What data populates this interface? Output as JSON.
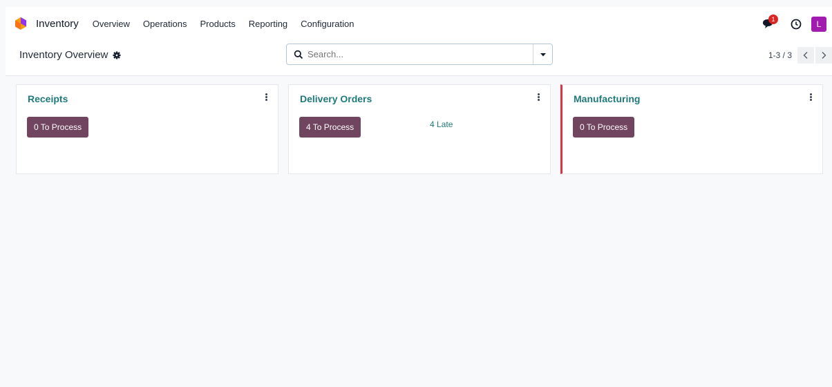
{
  "navbar": {
    "app_name": "Inventory",
    "menu": [
      "Overview",
      "Operations",
      "Products",
      "Reporting",
      "Configuration"
    ],
    "message_count": "1",
    "avatar_letter": "L"
  },
  "control_panel": {
    "title": "Inventory Overview",
    "search_placeholder": "Search...",
    "pager": "1-3 / 3"
  },
  "cards": [
    {
      "title": "Receipts",
      "button": "0 To Process",
      "late": "",
      "alert": false
    },
    {
      "title": "Delivery Orders",
      "button": "4 To Process",
      "late": "4 Late",
      "alert": false
    },
    {
      "title": "Manufacturing",
      "button": "0 To Process",
      "late": "",
      "alert": true
    }
  ],
  "colors": {
    "accent": "#71455f",
    "link": "#1f7a7a",
    "alert": "#dc3545",
    "avatar": "#a21caf"
  },
  "icons": [
    "app-logo-icon",
    "chat-icon",
    "clock-icon",
    "gear-icon",
    "search-icon",
    "caret-down-icon",
    "chevron-left-icon",
    "chevron-right-icon",
    "kebab-menu-icon"
  ]
}
